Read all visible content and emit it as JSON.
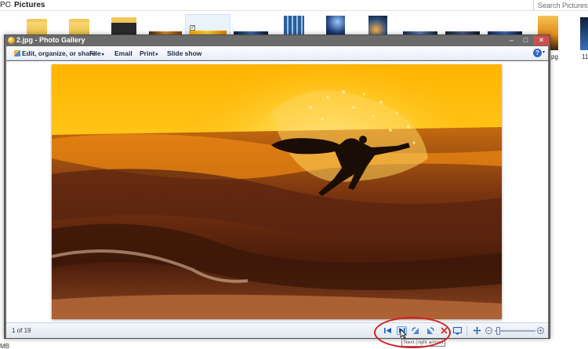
{
  "explorer": {
    "breadcrumb": [
      "PC",
      "Pictures"
    ],
    "breadcrumb_sep": "›",
    "search_placeholder": "Search Pictures",
    "side_labels": [
      "pg",
      "11"
    ],
    "status_text": "MB",
    "checkbox_mark": "✓"
  },
  "window": {
    "title": "2.jpg - Photo Gallery",
    "min_glyph": "–",
    "max_glyph": "□",
    "close_glyph": "✕"
  },
  "menu": {
    "edit_label": "Edit, organize, or share",
    "file_label": "File",
    "email_label": "Email",
    "print_label": "Print",
    "slideshow_label": "Slide show",
    "caret": "▾",
    "help_glyph": "?"
  },
  "photo": {
    "alt": "surfer silhouette at sunset"
  },
  "controls": {
    "counter": "1 of 19",
    "tooltip": "Next (right arrow)",
    "zoom_out_glyph": "−",
    "zoom_in_glyph": "+",
    "zoom_level": 0.05
  },
  "colors": {
    "annotation": "#d41f1f",
    "titlebar": "#6b6b6b",
    "close": "#c75050",
    "accent": "#2f67c7"
  }
}
